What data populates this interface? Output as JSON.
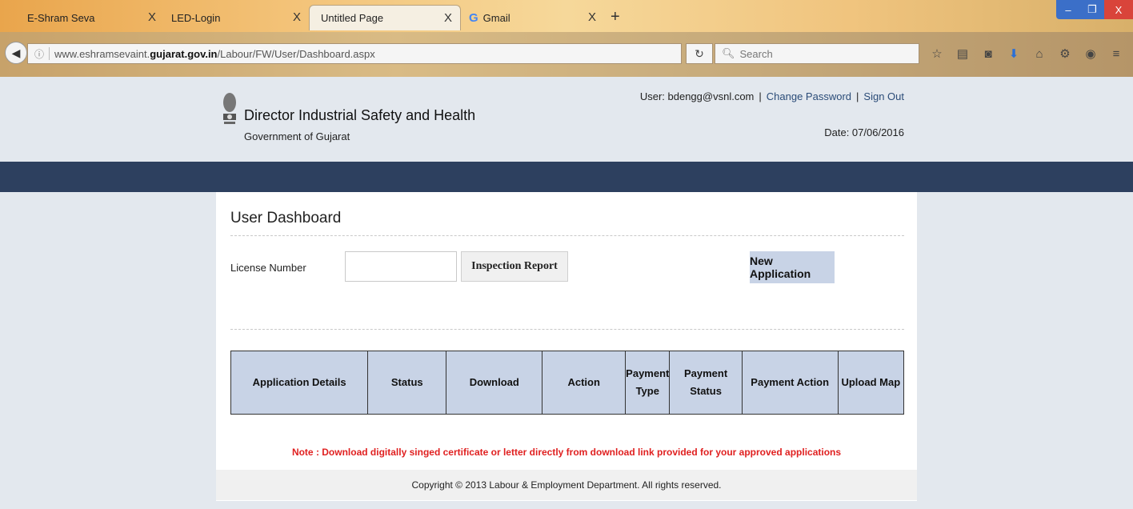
{
  "browser": {
    "tabs": [
      {
        "label": "E-Shram Seva",
        "close": "X"
      },
      {
        "label": "LED-Login",
        "close": "X"
      },
      {
        "label": "Untitled Page",
        "close": "X"
      },
      {
        "label": "Gmail",
        "close": "X"
      }
    ],
    "new_tab": "+",
    "url_prefix": "www.eshramsevaint.",
    "url_domain": "gujarat.gov.in",
    "url_path": "/Labour/FW/User/Dashboard.aspx",
    "search_placeholder": "Search",
    "window_buttons": {
      "minimize": "–",
      "maximize": "❐",
      "close": "X"
    }
  },
  "header": {
    "title": "Director Industrial Safety and Health",
    "subtitle": "Government of Gujarat",
    "user_label": "User: bdengg@vsnl.com",
    "separator": "|",
    "change_password": "Change Password",
    "sign_out": "Sign Out",
    "date": "Date: 07/06/2016"
  },
  "dashboard": {
    "title": "User Dashboard",
    "license_label": "License Number",
    "license_value": "",
    "inspection_button": "Inspection Report",
    "new_application_button": "New Application",
    "table": {
      "columns": [
        "Application Details",
        "Status",
        "Download",
        "Action",
        "Payment Type",
        "Payment Status",
        "Payment Action",
        "Upload Map"
      ],
      "rows": []
    },
    "note": "Note : Download digitally singed certificate or letter directly from download link provided for your approved applications"
  },
  "footer": {
    "copyright": "Copyright © 2013 Labour & Employment Department. All rights reserved."
  },
  "colors": {
    "nav_bar": "#2d405f",
    "table_header": "#c8d3e6",
    "note": "#e02020",
    "page_bg": "#e3e8ee"
  }
}
